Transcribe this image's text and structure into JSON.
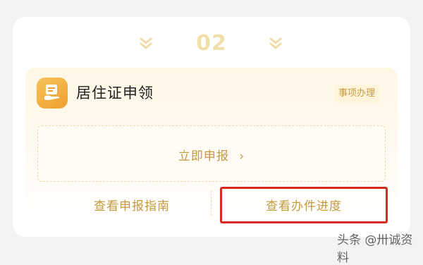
{
  "step": {
    "number": "02"
  },
  "service": {
    "icon": "id-card-hand-icon",
    "title": "居住证申领",
    "tag": "事项办理"
  },
  "actions": {
    "apply_label": "立即申报",
    "apply_chevron": "›",
    "guide_label": "查看申报指南",
    "progress_label": "查看办件进度"
  },
  "watermark": {
    "text": "头条 @卅诚资料"
  },
  "colors": {
    "accent_gold": "#c49a3e",
    "icon_orange": "#ef9f2e",
    "highlight_red": "#d82a22",
    "page_bg": "#f3f2f4"
  }
}
